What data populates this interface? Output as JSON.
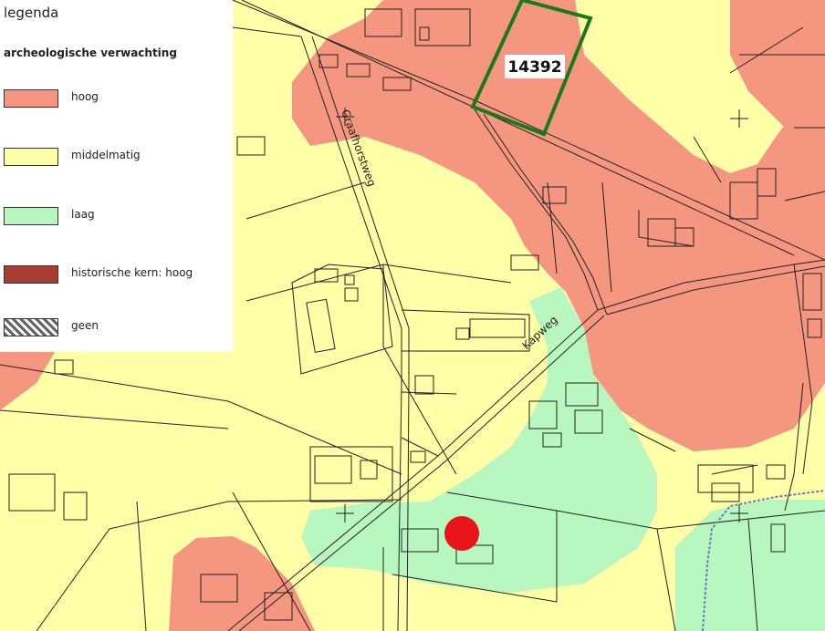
{
  "legend": {
    "title": "legenda",
    "subtitle": "archeologische verwachting",
    "items": [
      {
        "label": "hoog",
        "color": "#f59680"
      },
      {
        "label": "middelmatig",
        "color": "#ffffa8"
      },
      {
        "label": "laag",
        "color": "#b9f7c0"
      },
      {
        "label": "historische kern: hoog",
        "color": "#a83d33"
      },
      {
        "label": "geen",
        "color": "hatched"
      }
    ]
  },
  "map": {
    "parcel_label": "14392",
    "parcel_color": "#1a7a1a",
    "streets": [
      "Graafhorstweg",
      "Kapweg"
    ],
    "marker_color": "#e8141a"
  }
}
